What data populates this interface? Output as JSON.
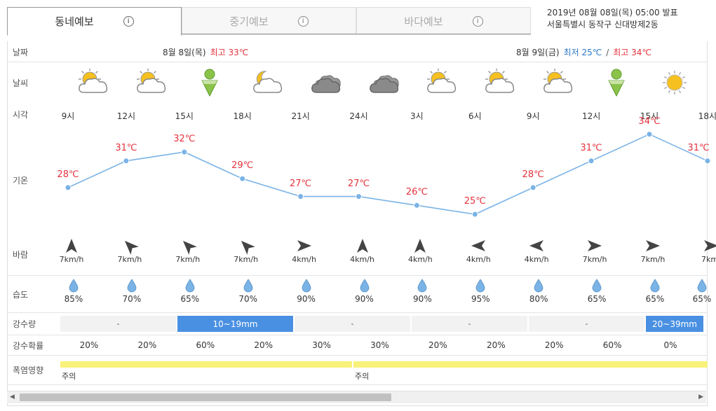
{
  "tabs": [
    {
      "label": "동네예보",
      "active": true
    },
    {
      "label": "중기예보",
      "active": false
    },
    {
      "label": "바다예보",
      "active": false
    }
  ],
  "tab_info_icon": "i",
  "announce": {
    "issued": "2019년 08월 08일(목) 05:00 발표",
    "location": "서울특별시 동작구 신대방제2동"
  },
  "row_labels": {
    "date": "날짜",
    "weather": "날씨",
    "time": "시각",
    "temp": "기온",
    "wind": "바람",
    "humidity": "습도",
    "precip": "강수량",
    "precip_prob": "강수확률",
    "heat": "폭염영향"
  },
  "dates": [
    {
      "label": "8월 8일(목)",
      "max_label": "최고 33℃"
    },
    {
      "label": "8월 9일(금)",
      "min_label": "최저 25℃",
      "sep": "/",
      "max_label": "최고 34℃"
    }
  ],
  "colors": {
    "hot": "#e4323c",
    "cold": "#2a78c8",
    "line": "#7ab3e6",
    "rain_bar": "#4a90e2",
    "heat_bar": "#f8f27a"
  },
  "hours": [
    "9시",
    "12시",
    "15시",
    "18시",
    "21시",
    "24시",
    "3시",
    "6시",
    "9시",
    "12시",
    "15시",
    "18시"
  ],
  "weather_icons": [
    "sun-cloud-icon",
    "sun-cloud-icon",
    "ultraviolet-icon",
    "moon-cloud-icon",
    "dark-cloud-icon",
    "dark-cloud-icon",
    "sun-cloud-icon",
    "sun-cloud-icon",
    "sun-cloud-icon",
    "ultraviolet-icon",
    "sun-icon"
  ],
  "chart_data": {
    "type": "line",
    "x": [
      "9시",
      "12시",
      "15시",
      "18시",
      "21시",
      "24시",
      "3시",
      "6시",
      "9시",
      "12시",
      "15시",
      "18시"
    ],
    "series": [
      {
        "values": [
          28,
          31,
          32,
          29,
          27,
          27,
          26,
          25,
          28,
          31,
          34,
          31
        ]
      }
    ],
    "labels": [
      "28℃",
      "31℃",
      "32℃",
      "29℃",
      "27℃",
      "27℃",
      "26℃",
      "25℃",
      "28℃",
      "31℃",
      "34℃",
      "31℃"
    ]
  },
  "wind": [
    {
      "dir": 0,
      "speed": "7km/h"
    },
    {
      "dir": -45,
      "speed": "7km/h"
    },
    {
      "dir": -45,
      "speed": "7km/h"
    },
    {
      "dir": -45,
      "speed": "7km/h"
    },
    {
      "dir": 90,
      "speed": "4km/h"
    },
    {
      "dir": 0,
      "speed": "4km/h"
    },
    {
      "dir": 0,
      "speed": "4km/h"
    },
    {
      "dir": -90,
      "speed": "4km/h"
    },
    {
      "dir": -90,
      "speed": "4km/h"
    },
    {
      "dir": 90,
      "speed": "7km/h"
    },
    {
      "dir": 90,
      "speed": "7km/h"
    },
    {
      "dir": 90,
      "speed": "7km/"
    }
  ],
  "humidity": [
    "85%",
    "70%",
    "65%",
    "70%",
    "90%",
    "90%",
    "90%",
    "95%",
    "80%",
    "65%",
    "65%",
    "65%"
  ],
  "precip": [
    "-",
    "10~19mm",
    "-",
    "-",
    "-",
    "20~39mm"
  ],
  "precip_prob": [
    "20%",
    "20%",
    "60%",
    "20%",
    "30%",
    "30%",
    "20%",
    "20%",
    "20%",
    "60%",
    "0%"
  ],
  "heat": [
    "주의",
    "주의"
  ]
}
